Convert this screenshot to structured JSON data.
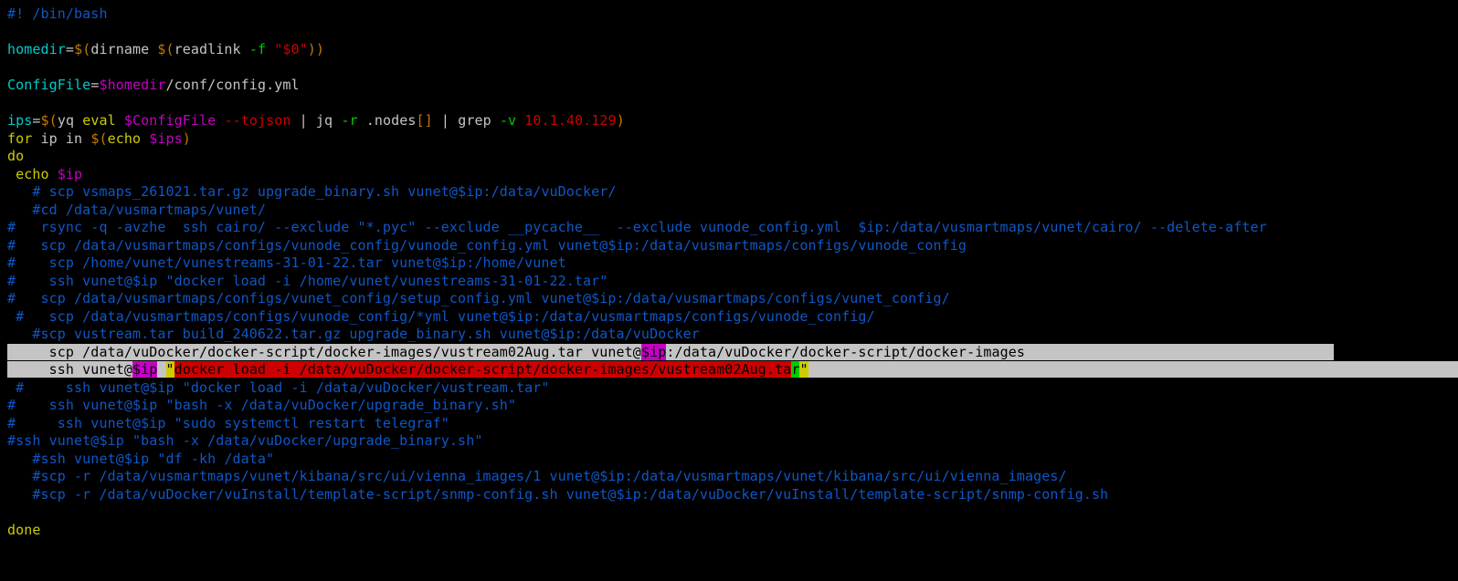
{
  "lines": {
    "l1_shebang": "#! /bin/bash",
    "l2_blank": "",
    "l3_homedir_var": "homedir",
    "l3_eq": "=",
    "l3_d1": "$(",
    "l3_dirname": "dirname ",
    "l3_d2": "$(",
    "l3_readlink": "readlink ",
    "l3_f": "-f",
    "l3_sp": " ",
    "l3_q0": "\"$0\"",
    "l3_d3": "))",
    "l4_blank": "",
    "l5_cfg_var": "ConfigFile",
    "l5_eq": "=",
    "l5_homedir": "$homedir",
    "l5_path": "/conf/config.yml",
    "l6_blank": "",
    "l7_ips_var": "ips",
    "l7_eq": "=",
    "l7_d1": "$(",
    "l7_yq": "yq ",
    "l7_eval": "eval ",
    "l7_cfg": "$ConfigFile",
    "l7_sp1": " ",
    "l7_tojson": "--tojson",
    "l7_pipe1": " | ",
    "l7_jq": "jq ",
    "l7_r": "-r",
    "l7_nodes": " .nodes",
    "l7_br": "[]",
    "l7_pipe2": " | ",
    "l7_grep": "grep ",
    "l7_v": "-v",
    "l7_sp2": " ",
    "l7_ip": "10.1.40.129",
    "l7_close": ")",
    "l8_for": "for",
    "l8_ip_in": " ip in ",
    "l8_d1": "$(",
    "l8_echo": "echo ",
    "l8_ips": "$ips",
    "l8_close": ")",
    "l9_do": "do",
    "l10_echo": " echo",
    "l10_sp": " ",
    "l10_ip": "$ip",
    "cmt1": "   # scp vsmaps_261021.tar.gz upgrade_binary.sh vunet@$ip:/data/vuDocker/",
    "cmt2": "   #cd /data/vusmartmaps/vunet/",
    "cmt3": "#   rsync -q -avzhe  ssh cairo/ --exclude \"*.pyc\" --exclude __pycache__  --exclude vunode_config.yml  $ip:/data/vusmartmaps/vunet/cairo/ --delete-after",
    "cmt4": "#   scp /data/vusmartmaps/configs/vunode_config/vunode_config.yml vunet@$ip:/data/vusmartmaps/configs/vunode_config",
    "cmt5": "#    scp /home/vunet/vunestreams-31-01-22.tar vunet@$ip:/home/vunet",
    "cmt6": "#    ssh vunet@$ip \"docker load -i /home/vunet/vunestreams-31-01-22.tar\"",
    "cmt7": "#   scp /data/vusmartmaps/configs/vunet_config/setup_config.yml vunet@$ip:/data/vusmartmaps/configs/vunet_config/",
    "cmt8": " #   scp /data/vusmartmaps/configs/vunode_config/*yml vunet@$ip:/data/vusmartmaps/configs/vunode_config/",
    "cmt9": "   #scp vustream.tar build_240622.tar.gz upgrade_binary.sh vunet@$ip:/data/vuDocker",
    "sel_pad1": "     ",
    "sel1_a": "scp /data/vuDocker/docker-script/docker-images/vustream02Aug.tar vunet@",
    "sel1_ip": "$ip",
    "sel1_b": ":/data/vuDocker/docker-script/docker-images",
    "sel_trail1": "                                     ",
    "sel_pad2": "     ",
    "sel2_a": "ssh vunet@",
    "sel2_ip": "$ip",
    "sel2_sp": " ",
    "sel2_q1": "\"",
    "sel2_cmd": "docker load -i /data/vuDocker/docker-script/docker-images/vustream02Aug.ta",
    "sel2_r": "r",
    "sel2_q2": "\"",
    "sel_trail2": "                                                                               ",
    "cmt10": " #     ssh vunet@$ip \"docker load -i /data/vuDocker/vustream.tar\"",
    "cmt11": "#    ssh vunet@$ip \"bash -x /data/vuDocker/upgrade_binary.sh\"",
    "cmt12": "#     ssh vunet@$ip \"sudo systemctl restart telegraf\"",
    "cmt13": "#ssh vunet@$ip \"bash -x /data/vuDocker/upgrade_binary.sh\"",
    "cmt14": "   #ssh vunet@$ip \"df -kh /data\"",
    "cmt15": "   #scp -r /data/vusmartmaps/vunet/kibana/src/ui/vienna_images/1 vunet@$ip:/data/vusmartmaps/vunet/kibana/src/ui/vienna_images/",
    "cmt16": "   #scp -r /data/vuDocker/vuInstall/template-script/snmp-config.sh vunet@$ip:/data/vuDocker/vuInstall/template-script/snmp-config.sh",
    "done": "done"
  }
}
